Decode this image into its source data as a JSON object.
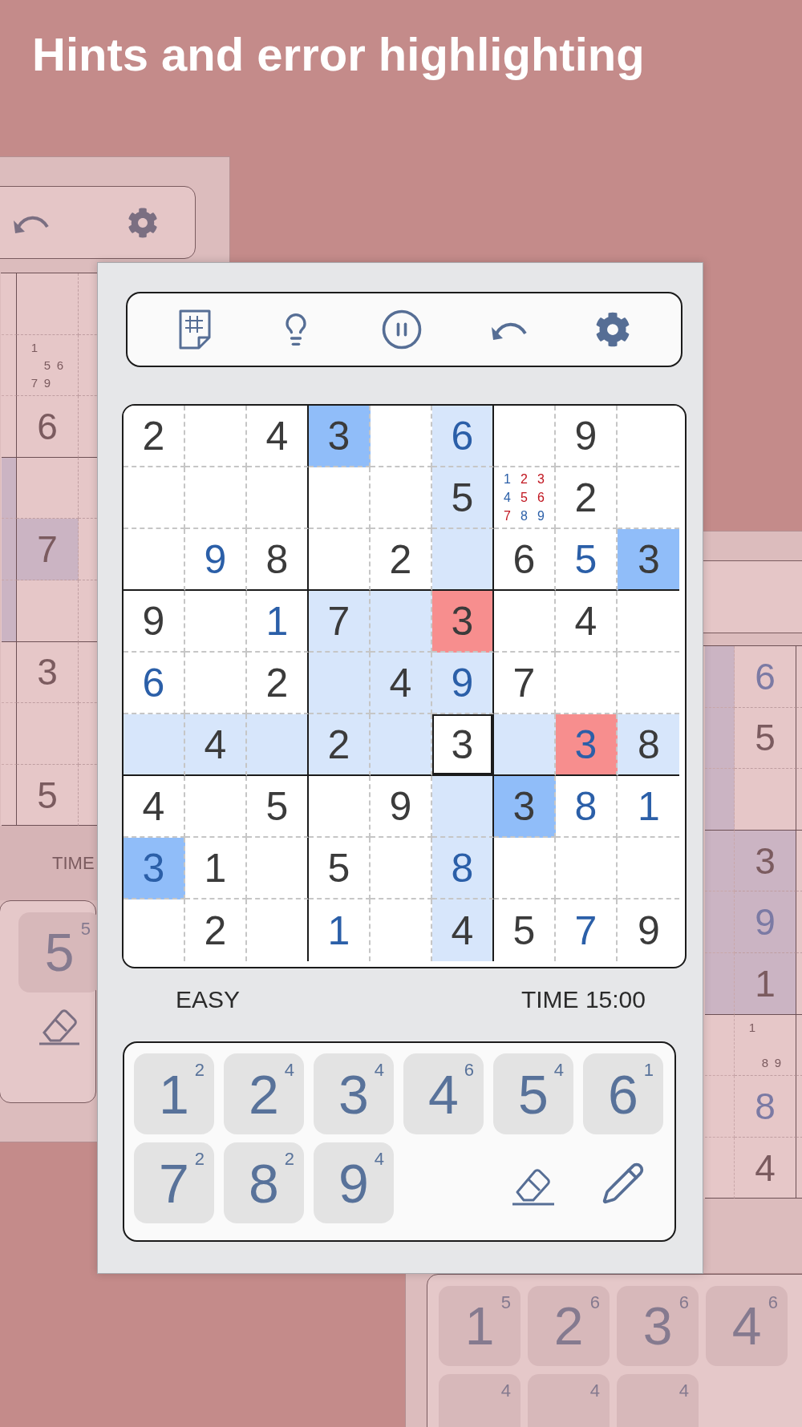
{
  "title": "Hints and error highlighting",
  "background_screens": [
    {
      "board_columns": [
        {
          "cells": [
            {
              "highlight": false
            },
            {
              "highlight": false,
              "kind": "notes",
              "note_rows": [
                [
                  "1",
                  null,
                  null
                ],
                [
                  null,
                  "5",
                  "6"
                ],
                [
                  "7",
                  "9",
                  null
                ]
              ]
            },
            {
              "highlight": false,
              "kind": "given",
              "value": "6"
            },
            {
              "highlight": false
            },
            {
              "highlight": true,
              "kind": "given",
              "value": "7"
            },
            {
              "highlight": false
            },
            {
              "highlight": false,
              "kind": "given",
              "value": "3"
            },
            {
              "highlight": false
            },
            {
              "highlight": false,
              "kind": "given",
              "value": "5"
            }
          ]
        }
      ],
      "column_highlight": true,
      "status": "TIME",
      "keys": [
        {
          "digit": "5",
          "count": "5"
        }
      ]
    },
    {
      "board_columns": [
        {
          "cells": [
            {
              "highlight": false,
              "kind": "entered",
              "value": "6"
            },
            {
              "highlight": false,
              "kind": "given",
              "value": "5"
            },
            {
              "highlight": false
            },
            {
              "highlight": true,
              "kind": "given",
              "value": "3"
            },
            {
              "highlight": true,
              "kind": "entered",
              "value": "9"
            },
            {
              "highlight": true,
              "kind": "given",
              "value": "1"
            },
            {
              "highlight": false,
              "kind": "notes",
              "note_rows": [
                [
                  "1",
                  null,
                  null
                ],
                [
                  null,
                  null,
                  null
                ],
                [
                  null,
                  "8",
                  "9"
                ]
              ]
            },
            {
              "highlight": false,
              "kind": "entered",
              "value": "8"
            },
            {
              "highlight": false,
              "kind": "given",
              "value": "4"
            }
          ]
        }
      ],
      "column_highlight": true,
      "keys": [
        {
          "digit": "1",
          "count": "5"
        },
        {
          "digit": "2",
          "count": "6"
        },
        {
          "digit": "3",
          "count": "6"
        },
        {
          "digit": "4",
          "count": "6"
        },
        {
          "count": "4"
        },
        {
          "count": "4"
        },
        {
          "count": "4"
        }
      ]
    }
  ],
  "game": {
    "board": [
      [
        {
          "kind": "given",
          "value": "2",
          "related": false,
          "matching": false,
          "conflict": false,
          "selected": false
        },
        {
          "kind": "empty",
          "related": false,
          "matching": false,
          "conflict": false,
          "selected": false
        },
        {
          "kind": "given",
          "value": "4",
          "related": false,
          "matching": false,
          "conflict": false,
          "selected": false
        },
        {
          "kind": "given",
          "value": "3",
          "related": false,
          "matching": true,
          "conflict": false,
          "selected": false
        },
        {
          "kind": "empty",
          "related": false,
          "matching": false,
          "conflict": false,
          "selected": false
        },
        {
          "kind": "entered",
          "value": "6",
          "related": true,
          "matching": false,
          "conflict": false,
          "selected": false
        },
        {
          "kind": "empty",
          "related": false,
          "matching": false,
          "conflict": false,
          "selected": false
        },
        {
          "kind": "given",
          "value": "9",
          "related": false,
          "matching": false,
          "conflict": false,
          "selected": false
        },
        {
          "kind": "empty",
          "related": false,
          "matching": false,
          "conflict": false,
          "selected": false
        }
      ],
      [
        {
          "kind": "empty",
          "related": false,
          "matching": false,
          "conflict": false,
          "selected": false
        },
        {
          "kind": "empty",
          "related": false,
          "matching": false,
          "conflict": false,
          "selected": false
        },
        {
          "kind": "empty",
          "related": false,
          "matching": false,
          "conflict": false,
          "selected": false
        },
        {
          "kind": "empty",
          "related": false,
          "matching": false,
          "conflict": false,
          "selected": false
        },
        {
          "kind": "empty",
          "related": false,
          "matching": false,
          "conflict": false,
          "selected": false
        },
        {
          "kind": "given",
          "value": "5",
          "related": true,
          "matching": false,
          "conflict": false,
          "selected": false
        },
        {
          "kind": "notes",
          "related": false,
          "matching": false,
          "conflict": false,
          "selected": false,
          "notes": [
            {
              "digit": "1",
              "conflict": false
            },
            {
              "digit": "2",
              "conflict": true
            },
            {
              "digit": "3",
              "conflict": true
            },
            {
              "digit": "4",
              "conflict": false
            },
            {
              "digit": "5",
              "conflict": true
            },
            {
              "digit": "6",
              "conflict": true
            },
            {
              "digit": "7",
              "conflict": true
            },
            {
              "digit": "8",
              "conflict": false
            },
            {
              "digit": "9",
              "conflict": false
            }
          ]
        },
        {
          "kind": "given",
          "value": "2",
          "related": false,
          "matching": false,
          "conflict": false,
          "selected": false
        },
        {
          "kind": "empty",
          "related": false,
          "matching": false,
          "conflict": false,
          "selected": false
        }
      ],
      [
        {
          "kind": "empty",
          "related": false,
          "matching": false,
          "conflict": false,
          "selected": false
        },
        {
          "kind": "entered",
          "value": "9",
          "related": false,
          "matching": false,
          "conflict": false,
          "selected": false
        },
        {
          "kind": "given",
          "value": "8",
          "related": false,
          "matching": false,
          "conflict": false,
          "selected": false
        },
        {
          "kind": "empty",
          "related": false,
          "matching": false,
          "conflict": false,
          "selected": false
        },
        {
          "kind": "given",
          "value": "2",
          "related": false,
          "matching": false,
          "conflict": false,
          "selected": false
        },
        {
          "kind": "empty",
          "related": true,
          "matching": false,
          "conflict": false,
          "selected": false
        },
        {
          "kind": "given",
          "value": "6",
          "related": false,
          "matching": false,
          "conflict": false,
          "selected": false
        },
        {
          "kind": "entered",
          "value": "5",
          "related": false,
          "matching": false,
          "conflict": false,
          "selected": false
        },
        {
          "kind": "given",
          "value": "3",
          "related": false,
          "matching": true,
          "conflict": false,
          "selected": false
        }
      ],
      [
        {
          "kind": "given",
          "value": "9",
          "related": false,
          "matching": false,
          "conflict": false,
          "selected": false
        },
        {
          "kind": "empty",
          "related": false,
          "matching": false,
          "conflict": false,
          "selected": false
        },
        {
          "kind": "entered",
          "value": "1",
          "related": false,
          "matching": false,
          "conflict": false,
          "selected": false
        },
        {
          "kind": "given",
          "value": "7",
          "related": true,
          "matching": false,
          "conflict": false,
          "selected": false
        },
        {
          "kind": "empty",
          "related": true,
          "matching": false,
          "conflict": false,
          "selected": false
        },
        {
          "kind": "given",
          "value": "3",
          "related": false,
          "matching": false,
          "conflict": true,
          "selected": false
        },
        {
          "kind": "empty",
          "related": false,
          "matching": false,
          "conflict": false,
          "selected": false
        },
        {
          "kind": "given",
          "value": "4",
          "related": false,
          "matching": false,
          "conflict": false,
          "selected": false
        },
        {
          "kind": "empty",
          "related": false,
          "matching": false,
          "conflict": false,
          "selected": false
        }
      ],
      [
        {
          "kind": "entered",
          "value": "6",
          "related": false,
          "matching": false,
          "conflict": false,
          "selected": false
        },
        {
          "kind": "empty",
          "related": false,
          "matching": false,
          "conflict": false,
          "selected": false
        },
        {
          "kind": "given",
          "value": "2",
          "related": false,
          "matching": false,
          "conflict": false,
          "selected": false
        },
        {
          "kind": "empty",
          "related": true,
          "matching": false,
          "conflict": false,
          "selected": false
        },
        {
          "kind": "given",
          "value": "4",
          "related": true,
          "matching": false,
          "conflict": false,
          "selected": false
        },
        {
          "kind": "entered",
          "value": "9",
          "related": true,
          "matching": false,
          "conflict": false,
          "selected": false
        },
        {
          "kind": "given",
          "value": "7",
          "related": false,
          "matching": false,
          "conflict": false,
          "selected": false
        },
        {
          "kind": "empty",
          "related": false,
          "matching": false,
          "conflict": false,
          "selected": false
        },
        {
          "kind": "empty",
          "related": false,
          "matching": false,
          "conflict": false,
          "selected": false
        }
      ],
      [
        {
          "kind": "empty",
          "related": true,
          "matching": false,
          "conflict": false,
          "selected": false
        },
        {
          "kind": "given",
          "value": "4",
          "related": true,
          "matching": false,
          "conflict": false,
          "selected": false
        },
        {
          "kind": "empty",
          "related": true,
          "matching": false,
          "conflict": false,
          "selected": false
        },
        {
          "kind": "given",
          "value": "2",
          "related": true,
          "matching": false,
          "conflict": false,
          "selected": false
        },
        {
          "kind": "empty",
          "related": true,
          "matching": false,
          "conflict": false,
          "selected": false
        },
        {
          "kind": "given",
          "value": "3",
          "related": false,
          "matching": false,
          "conflict": false,
          "selected": true
        },
        {
          "kind": "empty",
          "related": true,
          "matching": false,
          "conflict": false,
          "selected": false
        },
        {
          "kind": "entered",
          "value": "3",
          "related": false,
          "matching": false,
          "conflict": true,
          "selected": false
        },
        {
          "kind": "given",
          "value": "8",
          "related": true,
          "matching": false,
          "conflict": false,
          "selected": false
        }
      ],
      [
        {
          "kind": "given",
          "value": "4",
          "related": false,
          "matching": false,
          "conflict": false,
          "selected": false
        },
        {
          "kind": "empty",
          "related": false,
          "matching": false,
          "conflict": false,
          "selected": false
        },
        {
          "kind": "given",
          "value": "5",
          "related": false,
          "matching": false,
          "conflict": false,
          "selected": false
        },
        {
          "kind": "empty",
          "related": false,
          "matching": false,
          "conflict": false,
          "selected": false
        },
        {
          "kind": "given",
          "value": "9",
          "related": false,
          "matching": false,
          "conflict": false,
          "selected": false
        },
        {
          "kind": "empty",
          "related": true,
          "matching": false,
          "conflict": false,
          "selected": false
        },
        {
          "kind": "given",
          "value": "3",
          "related": false,
          "matching": true,
          "conflict": false,
          "selected": false
        },
        {
          "kind": "entered",
          "value": "8",
          "related": false,
          "matching": false,
          "conflict": false,
          "selected": false
        },
        {
          "kind": "entered",
          "value": "1",
          "related": false,
          "matching": false,
          "conflict": false,
          "selected": false
        }
      ],
      [
        {
          "kind": "entered",
          "value": "3",
          "related": false,
          "matching": true,
          "conflict": false,
          "selected": false
        },
        {
          "kind": "given",
          "value": "1",
          "related": false,
          "matching": false,
          "conflict": false,
          "selected": false
        },
        {
          "kind": "empty",
          "related": false,
          "matching": false,
          "conflict": false,
          "selected": false
        },
        {
          "kind": "given",
          "value": "5",
          "related": false,
          "matching": false,
          "conflict": false,
          "selected": false
        },
        {
          "kind": "empty",
          "related": false,
          "matching": false,
          "conflict": false,
          "selected": false
        },
        {
          "kind": "entered",
          "value": "8",
          "related": true,
          "matching": false,
          "conflict": false,
          "selected": false
        },
        {
          "kind": "empty",
          "related": false,
          "matching": false,
          "conflict": false,
          "selected": false
        },
        {
          "kind": "empty",
          "related": false,
          "matching": false,
          "conflict": false,
          "selected": false
        },
        {
          "kind": "empty",
          "related": false,
          "matching": false,
          "conflict": false,
          "selected": false
        }
      ],
      [
        {
          "kind": "empty",
          "related": false,
          "matching": false,
          "conflict": false,
          "selected": false
        },
        {
          "kind": "given",
          "value": "2",
          "related": false,
          "matching": false,
          "conflict": false,
          "selected": false
        },
        {
          "kind": "empty",
          "related": false,
          "matching": false,
          "conflict": false,
          "selected": false
        },
        {
          "kind": "entered",
          "value": "1",
          "related": false,
          "matching": false,
          "conflict": false,
          "selected": false
        },
        {
          "kind": "empty",
          "related": false,
          "matching": false,
          "conflict": false,
          "selected": false
        },
        {
          "kind": "given",
          "value": "4",
          "related": true,
          "matching": false,
          "conflict": false,
          "selected": false
        },
        {
          "kind": "given",
          "value": "5",
          "related": false,
          "matching": false,
          "conflict": false,
          "selected": false
        },
        {
          "kind": "entered",
          "value": "7",
          "related": false,
          "matching": false,
          "conflict": false,
          "selected": false
        },
        {
          "kind": "given",
          "value": "9",
          "related": false,
          "matching": false,
          "conflict": false,
          "selected": false
        }
      ]
    ],
    "difficulty": "EASY",
    "time": "TIME 15:00",
    "keys": [
      {
        "digit": "1",
        "count": "2"
      },
      {
        "digit": "2",
        "count": "4"
      },
      {
        "digit": "3",
        "count": "4"
      },
      {
        "digit": "4",
        "count": "6"
      },
      {
        "digit": "5",
        "count": "4"
      },
      {
        "digit": "6",
        "count": "1"
      },
      {
        "digit": "7",
        "count": "2"
      },
      {
        "digit": "8",
        "count": "2"
      },
      {
        "digit": "9",
        "count": "4"
      }
    ]
  }
}
